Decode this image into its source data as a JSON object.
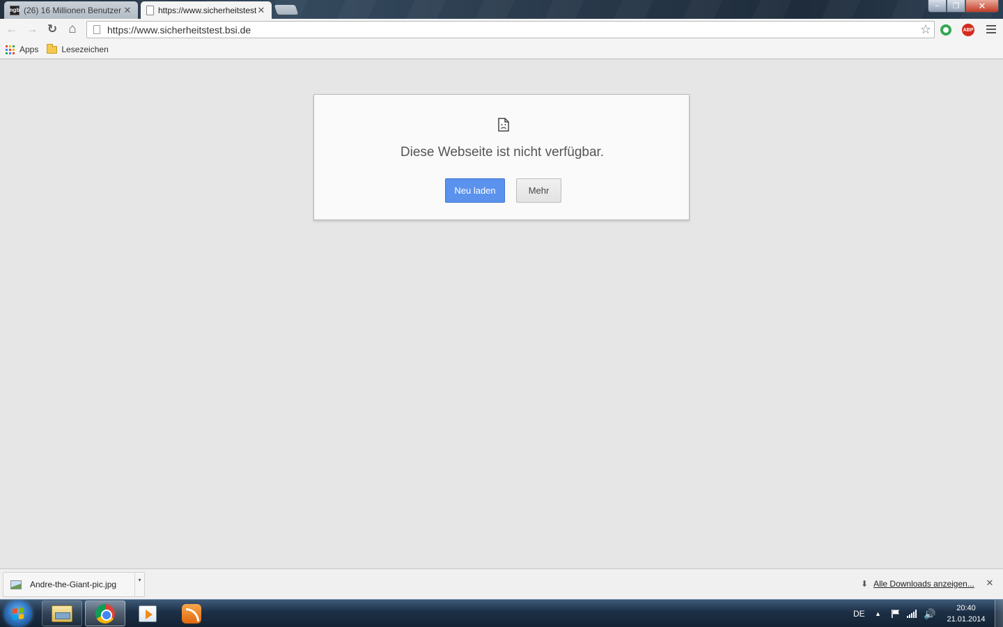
{
  "tabs": [
    {
      "title": "(26) 16 Millionen Benutzer",
      "favicon": "ngb-favicon",
      "favicon_text": "ngb",
      "active": false
    },
    {
      "title": "https://www.sicherheitstest.bsi.de",
      "favicon": "page-icon",
      "active": true
    }
  ],
  "window_controls": {
    "minimize": "−",
    "maximize": "❐",
    "close": "✕"
  },
  "toolbar": {
    "back_icon": "←",
    "forward_icon": "→",
    "reload_icon": "↻",
    "home_icon": "⌂",
    "url": "https://www.sicherheitstest.bsi.de",
    "star_icon": "☆",
    "extensions": [
      {
        "name": "green-ring-extension-icon",
        "color": "#34a853"
      },
      {
        "name": "adblock-plus-icon",
        "label": "ABP",
        "color": "#d42b1e"
      }
    ]
  },
  "bookmarks": {
    "apps_label": "Apps",
    "folder_label": "Lesezeichen",
    "apps_colors": [
      "#e8453c",
      "#f4b400",
      "#34a853",
      "#4285f4",
      "#e8453c",
      "#f4b400",
      "#34a853",
      "#4285f4",
      "#e8453c"
    ]
  },
  "error": {
    "message": "Diese Webseite ist nicht verfügbar.",
    "reload_button": "Neu laden",
    "more_button": "Mehr",
    "accent_color": "#5a92ed"
  },
  "download_shelf": {
    "file_name": "Andre-the-Giant-pic.jpg",
    "dropdown_icon": "▾",
    "show_all_label": "Alle Downloads anzeigen...",
    "download_arrow_icon": "⬇",
    "close_icon": "✕"
  },
  "taskbar": {
    "apps": [
      {
        "name": "explorer",
        "state": "pinned"
      },
      {
        "name": "chrome",
        "state": "active"
      },
      {
        "name": "media-player",
        "state": "idle"
      },
      {
        "name": "rss-reader",
        "state": "idle"
      }
    ],
    "language": "DE",
    "tray_arrow": "▲",
    "volume_icon": "🔊",
    "time": "20:40",
    "date": "21.01.2014",
    "start_logo_colors": [
      "#f25022",
      "#7fba00",
      "#00a4ef",
      "#ffb900"
    ]
  }
}
